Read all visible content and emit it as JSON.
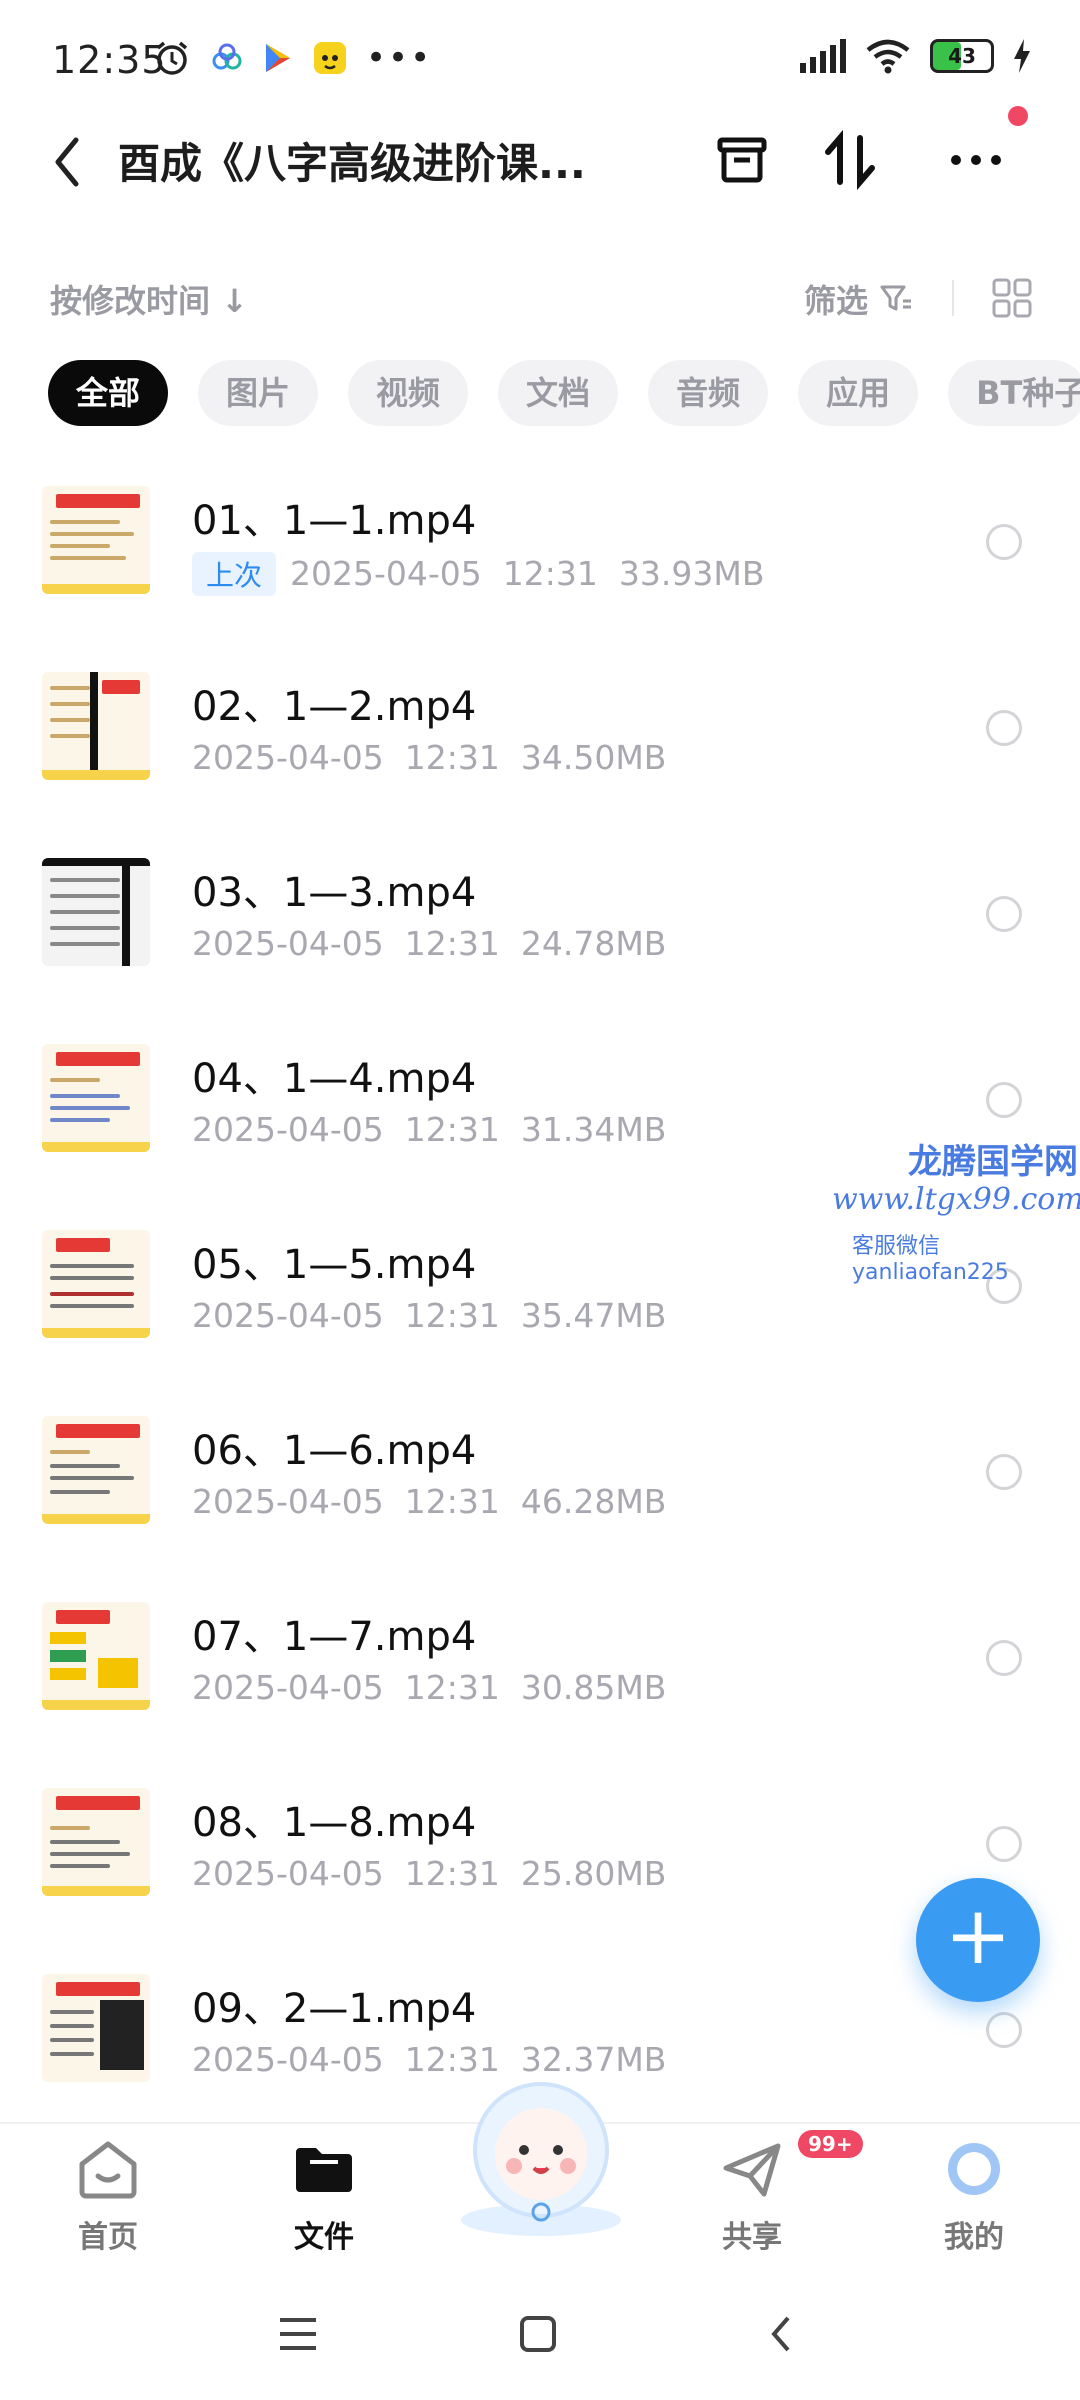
{
  "status_bar": {
    "time": "12:35",
    "battery": "43"
  },
  "header": {
    "title": "酉成《八字高级进阶课..."
  },
  "toolbar": {
    "sort_label": "按修改时间 ↓",
    "filter_label": "筛选"
  },
  "tabs": [
    "全部",
    "图片",
    "视频",
    "文档",
    "音频",
    "应用",
    "BT种子"
  ],
  "files": [
    {
      "name": "01、1—1.mp4",
      "tag": "上次",
      "date": "2025-04-05",
      "time": "12:31",
      "size": "33.93MB"
    },
    {
      "name": "02、1—2.mp4",
      "date": "2025-04-05",
      "time": "12:31",
      "size": "34.50MB"
    },
    {
      "name": "03、1—3.mp4",
      "date": "2025-04-05",
      "time": "12:31",
      "size": "24.78MB"
    },
    {
      "name": "04、1—4.mp4",
      "date": "2025-04-05",
      "time": "12:31",
      "size": "31.34MB"
    },
    {
      "name": "05、1—5.mp4",
      "date": "2025-04-05",
      "time": "12:31",
      "size": "35.47MB"
    },
    {
      "name": "06、1—6.mp4",
      "date": "2025-04-05",
      "time": "12:31",
      "size": "46.28MB"
    },
    {
      "name": "07、1—7.mp4",
      "date": "2025-04-05",
      "time": "12:31",
      "size": "30.85MB"
    },
    {
      "name": "08、1—8.mp4",
      "date": "2025-04-05",
      "time": "12:31",
      "size": "25.80MB"
    },
    {
      "name": "09、2—1.mp4",
      "date": "2025-04-05",
      "time": "12:31",
      "size": "32.37MB"
    }
  ],
  "watermark": {
    "line1": "龙腾国学网",
    "line2": "www.ltgx99.com",
    "line3": "客服微信 yanliaofan225"
  },
  "bottom_nav": {
    "home": "首页",
    "files": "文件",
    "share": "共享",
    "share_badge": "99+",
    "me": "我的"
  },
  "colors": {
    "accent": "#3a9bf3",
    "badge": "#f04864",
    "active_chip": "#0a0a0a"
  }
}
